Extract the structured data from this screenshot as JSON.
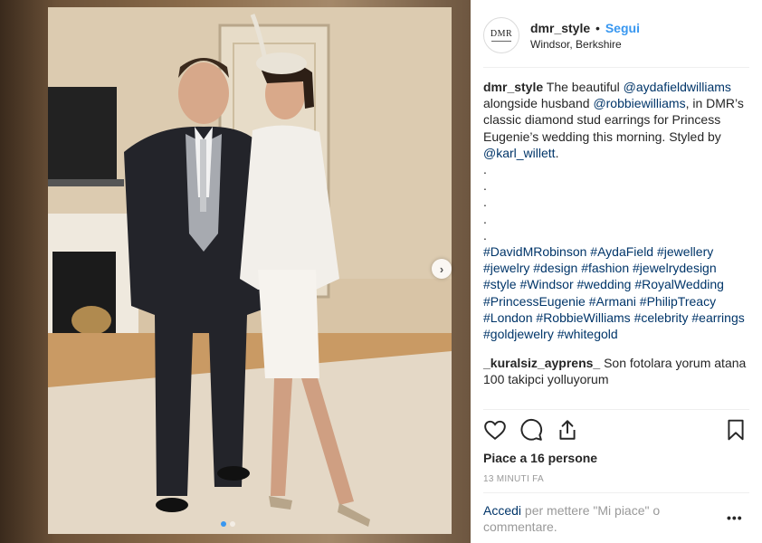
{
  "post": {
    "username": "dmr_style",
    "separator": "•",
    "follow_label": "Segui",
    "location": "Windsor, Berkshire",
    "avatar_logo": "DMR",
    "carousel_next": "›"
  },
  "caption": {
    "username": "dmr_style",
    "text_1": " The beautiful ",
    "mention_1": "@aydafieldwilliams",
    "text_2": " alongside husband ",
    "mention_2": "@robbiewilliams",
    "text_3": ", in DMR’s classic diamond stud earrings for Princess Eugenie’s wedding this morning. Styled by ",
    "mention_3": "@karl_willett",
    "text_4": ".",
    "dots": [
      ".",
      ".",
      ".",
      ".",
      "."
    ],
    "hashtags": [
      "#DavidMRobinson",
      "#AydaField",
      "#jewellery",
      "#jewelry",
      "#design",
      "#fashion",
      "#jewelrydesign",
      "#style",
      "#Windsor",
      "#wedding",
      "#RoyalWedding",
      "#PrincessEugenie",
      "#Armani",
      "#PhilipTreacy",
      "#London",
      "#RobbieWilliams",
      "#celebrity",
      "#earrings",
      "#goldjewelry",
      "#whitegold"
    ]
  },
  "comment": {
    "username": "_kuralsiz_ayprens_",
    "text": " Son fotolara yorum atana 100 takipci yolluyorum"
  },
  "stats": {
    "likes_prefix": "Piace a ",
    "likes_count": "16 persone",
    "time": "13 MINUTI FA"
  },
  "footer": {
    "login_link": "Accedi",
    "login_text": " per mettere \"Mi piace\" o commentare.",
    "more": "•••"
  },
  "icons": {
    "like": "heart-icon",
    "comment": "comment-bubble-icon",
    "share": "share-icon",
    "save": "bookmark-icon"
  },
  "colors": {
    "accent": "#3897f0",
    "link": "#003569",
    "text": "#262626",
    "muted": "#999999"
  }
}
